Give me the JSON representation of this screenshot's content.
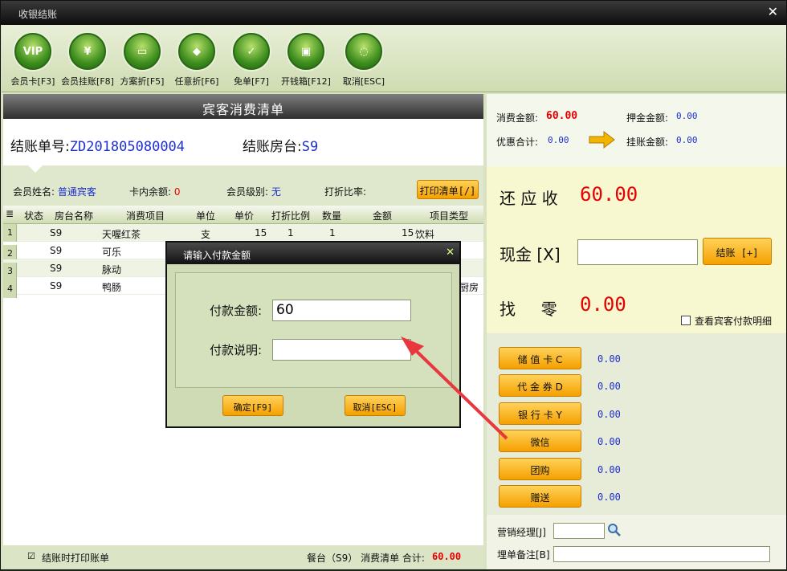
{
  "window": {
    "title": "收银结账",
    "close": "✕"
  },
  "toolbar": [
    {
      "icon": "VIP",
      "label": "会员卡[F3]"
    },
    {
      "icon": "¥",
      "label": "会员挂账[F8]"
    },
    {
      "icon": "▭",
      "label": "方案折[F5]"
    },
    {
      "icon": "◆",
      "label": "任意折[F6]"
    },
    {
      "icon": "✓",
      "label": "免单[F7]"
    },
    {
      "icon": "▣",
      "label": "开钱箱[F12]"
    },
    {
      "icon": "◌",
      "label": "取消[ESC]"
    }
  ],
  "bill": {
    "header": "宾客消费清单",
    "no_label": "结账单号:",
    "no": "ZD201805080004",
    "room_label": "结账房台:",
    "room": "S9"
  },
  "member": {
    "name_label": "会员姓名:",
    "name": "普通宾客",
    "balance_label": "卡内余额:",
    "balance": "0",
    "level_label": "会员级别:",
    "level": "无",
    "discount_label": "打折比率:",
    "print_btn": "打印清单[/]"
  },
  "grid": {
    "columns": [
      "状态",
      "房台名称",
      "消费项目",
      "单位",
      "单价",
      "打折比例",
      "数量",
      "金额",
      "项目类型"
    ],
    "rows": [
      {
        "n": "1",
        "room": "S9",
        "item": "天喔红茶",
        "unit": "支",
        "price": "15",
        "disc": "1",
        "qty": "1",
        "amount": "15",
        "type": "饮料"
      },
      {
        "n": "2",
        "room": "S9",
        "item": "可乐",
        "unit": "",
        "price": "",
        "disc": "",
        "qty": "",
        "amount": "",
        "type": ""
      },
      {
        "n": "3",
        "room": "S9",
        "item": "脉动",
        "unit": "",
        "price": "",
        "disc": "",
        "qty": "",
        "amount": "",
        "type": ""
      },
      {
        "n": "4",
        "room": "S9",
        "item": "鸭肠",
        "unit": "",
        "price": "",
        "disc": "",
        "qty": "",
        "amount": "",
        "type": "厨房"
      }
    ]
  },
  "status": {
    "print_on_checkout": "结账时打印账单",
    "summary_prefix": "餐台（S9） 消费清单 合计:",
    "total": "60.00"
  },
  "summary": {
    "consume_label": "消费金额:",
    "consume": "60.00",
    "deposit_label": "押金金额:",
    "deposit": "0.00",
    "discount_label": "优惠合计:",
    "discount": "0.00",
    "credit_label": "挂账金额:",
    "credit": "0.00"
  },
  "due": {
    "receivable_label": "还 应 收",
    "receivable": "60.00",
    "cash_label": "现金 [X]",
    "cash_value": "",
    "checkout_btn": "结账 [+]",
    "change_label": "找     零",
    "change": "0.00",
    "detail_checkbox": "查看宾客付款明细"
  },
  "payments": [
    {
      "label": "储 值 卡 C",
      "value": "0.00"
    },
    {
      "label": "代 金 券 D",
      "value": "0.00"
    },
    {
      "label": "银 行 卡 Y",
      "value": "0.00"
    },
    {
      "label": "微信",
      "value": "0.00"
    },
    {
      "label": "团购",
      "value": "0.00"
    },
    {
      "label": "赠送",
      "value": "0.00"
    }
  ],
  "extra": {
    "manager_label": "营销经理[J]",
    "remark_label": "埋单备注[B]"
  },
  "dialog": {
    "title": "请输入付款金额",
    "amount_label": "付款金额:",
    "amount_value": "60",
    "note_label": "付款说明:",
    "note_value": "",
    "ok": "确定[F9]",
    "cancel": "取消[ESC]"
  },
  "colors": {
    "accent": "#f5a000",
    "amount": "#e60000",
    "value_blue": "#1f2fd0",
    "arrow": "#e8383d"
  }
}
